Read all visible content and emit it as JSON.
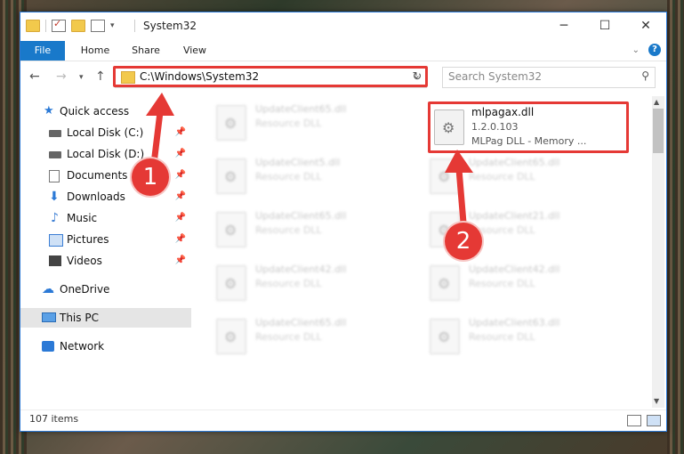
{
  "window": {
    "title": "System32"
  },
  "ribbon": {
    "tabs": [
      "File",
      "Home",
      "Share",
      "View"
    ]
  },
  "address": {
    "path": "C:\\Windows\\System32",
    "search_placeholder": "Search System32"
  },
  "sidebar": {
    "items": [
      {
        "label": "Quick access",
        "icon": "star-icon"
      },
      {
        "label": "Local Disk (C:)",
        "icon": "drive-icon",
        "pinned": true
      },
      {
        "label": "Local Disk (D:)",
        "icon": "drive-icon",
        "pinned": true
      },
      {
        "label": "Documents",
        "icon": "documents-icon",
        "pinned": true
      },
      {
        "label": "Downloads",
        "icon": "downloads-icon",
        "pinned": true
      },
      {
        "label": "Music",
        "icon": "music-icon",
        "pinned": true
      },
      {
        "label": "Pictures",
        "icon": "pictures-icon",
        "pinned": true
      },
      {
        "label": "Videos",
        "icon": "videos-icon",
        "pinned": true
      },
      {
        "label": "OneDrive",
        "icon": "cloud-icon"
      },
      {
        "label": "This PC",
        "icon": "computer-icon",
        "selected": true
      },
      {
        "label": "Network",
        "icon": "network-icon"
      }
    ]
  },
  "files": {
    "left": [
      {
        "name": "UpdateClient65.dll",
        "desc": "Resource DLL"
      },
      {
        "name": "UpdateClient5.dll",
        "desc": "Resource DLL"
      },
      {
        "name": "UpdateClient65.dll",
        "desc": "Resource DLL"
      },
      {
        "name": "UpdateClient42.dll",
        "desc": "Resource DLL"
      },
      {
        "name": "UpdateClient65.dll",
        "desc": "Resource DLL"
      }
    ],
    "right": [
      {
        "name": "UpdateClient65.dll",
        "desc": "Resource DLL"
      },
      {
        "name": "UpdateClient21.dll",
        "desc": "Resource DLL"
      },
      {
        "name": "UpdateClient42.dll",
        "desc": "Resource DLL"
      },
      {
        "name": "UpdateClient63.dll",
        "desc": "Resource DLL"
      }
    ],
    "highlighted": {
      "name": "mlpagax.dll",
      "version": "1.2.0.103",
      "desc": "MLPag DLL - Memory ..."
    }
  },
  "status": {
    "items": "107 items"
  },
  "annotations": {
    "badge1": "1",
    "badge2": "2",
    "color": "#e53935"
  }
}
